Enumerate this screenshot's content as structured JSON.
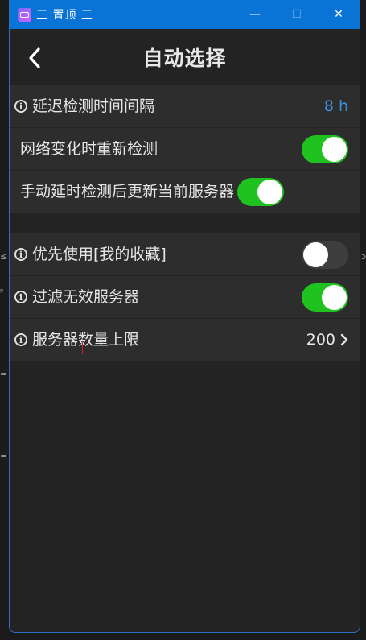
{
  "window": {
    "title": "三 置顶 三",
    "controls": {
      "minimize": "—",
      "maximize": "☐",
      "close": "✕"
    }
  },
  "header": {
    "title": "自动选择"
  },
  "section1": {
    "latency_interval": {
      "label": "延迟检测时间间隔",
      "value": "8 h"
    },
    "recheck_on_network_change": {
      "label": "网络变化时重新检测",
      "enabled": true
    },
    "update_after_manual_test": {
      "label": "手动延时检测后更新当前服务器",
      "enabled": true
    }
  },
  "section2": {
    "prefer_favorites": {
      "label": "优先使用[我的收藏]",
      "enabled": false
    },
    "filter_invalid": {
      "label": "过滤无效服务器",
      "enabled": true
    },
    "server_limit": {
      "label": "服务器数量上限",
      "value": "200"
    }
  },
  "colors": {
    "accent": "#0a74d6",
    "toggle_on": "#1fc21f",
    "value_blue": "#3d8fd9"
  }
}
